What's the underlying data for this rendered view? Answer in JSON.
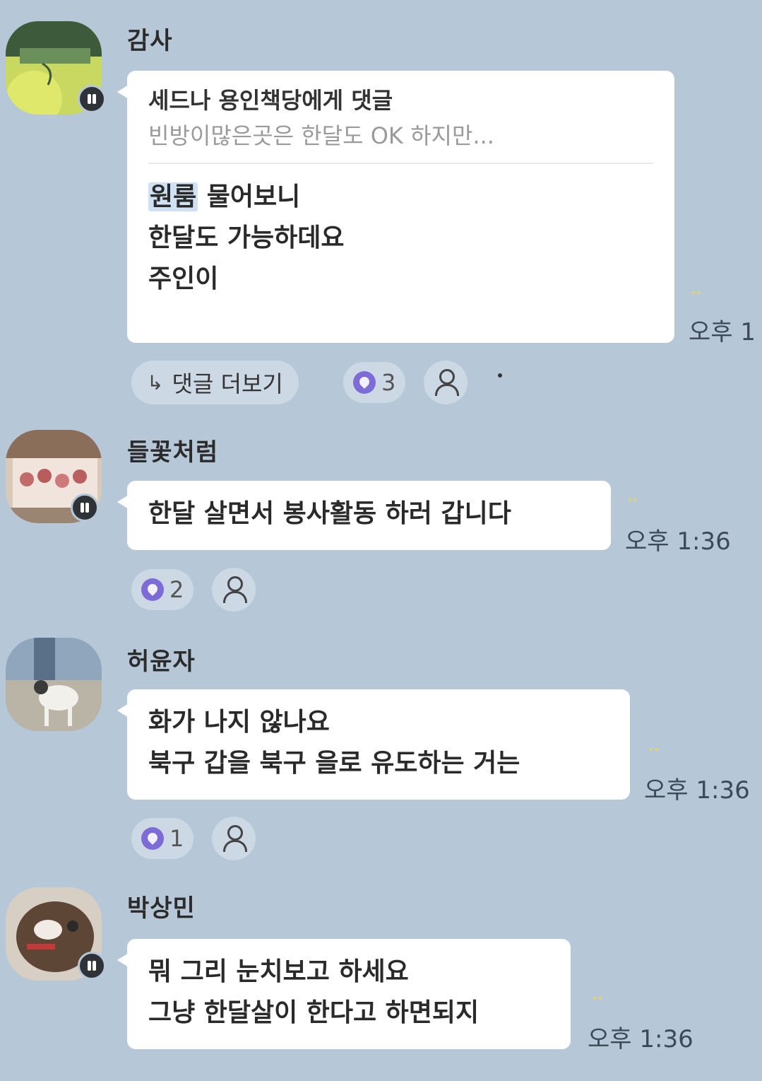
{
  "messages": [
    {
      "sender": "감사",
      "reply_to": "세드나 용인책당에게 댓글",
      "reply_preview": "빈방이많은곳은 한달도 OK 하지만...",
      "highlight": "원룸",
      "lines": [
        " 물어보니",
        "한달도 가능하데요",
        "주인이"
      ],
      "time": "오후 1",
      "more_comments": "댓글 더보기",
      "likes": "3"
    },
    {
      "sender": "들꽃처럼",
      "lines": [
        "한달 살면서 봉사활동 하러 갑니다"
      ],
      "time": "오후 1:36",
      "likes": "2"
    },
    {
      "sender": "허윤자",
      "lines": [
        "화가 나지 않나요",
        "북구 갑을 북구 을로 유도하는 거는"
      ],
      "time": "오후 1:36",
      "likes": "1"
    },
    {
      "sender": "박상민",
      "lines": [
        "뭐 그리  눈치보고  하세요",
        "그냥 한달살이 한다고 하면되지"
      ],
      "time": "오후 1:36"
    }
  ],
  "colors": {
    "background": "#b6c7d8",
    "bubble": "#ffffff",
    "reaction_accent": "#7d6bd6",
    "unread": "#e5d36a"
  },
  "icons": [
    "talk-badge-icon",
    "reply-arrow-icon",
    "heart-reaction-icon",
    "person-icon"
  ]
}
